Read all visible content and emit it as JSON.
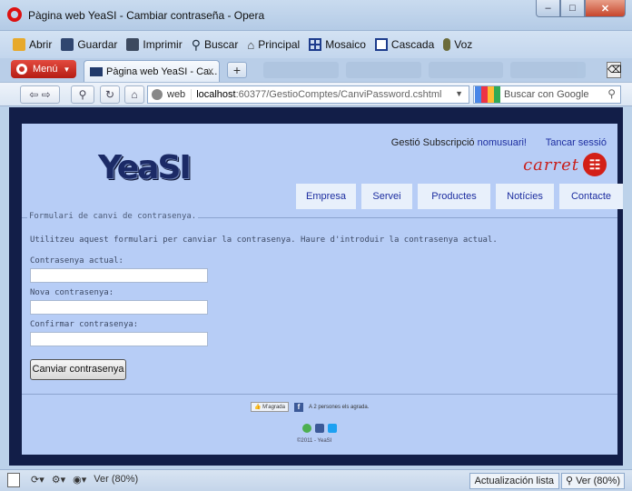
{
  "window": {
    "title": "Pàgina web YeaSI - Cambiar contraseña - Opera"
  },
  "menubar": {
    "items": [
      {
        "label": "Abrir",
        "icon": "folder-icon"
      },
      {
        "label": "Guardar",
        "icon": "save-icon"
      },
      {
        "label": "Imprimir",
        "icon": "print-icon"
      },
      {
        "label": "Buscar",
        "icon": "search-icon"
      },
      {
        "label": "Principal",
        "icon": "home-icon"
      },
      {
        "label": "Mosaico",
        "icon": "tile-icon"
      },
      {
        "label": "Cascada",
        "icon": "cascade-icon"
      },
      {
        "label": "Voz",
        "icon": "microphone-icon"
      }
    ]
  },
  "tabbar": {
    "menu_label": "Menú",
    "tab_title": "Pàgina web YeaSI - Ca...",
    "close_glyph": "x",
    "new_tab_glyph": "+"
  },
  "navbar": {
    "scheme": "web",
    "url_host": "localhost",
    "url_path": ":60377/GestioComptes/CanviPassword.cshtml",
    "search_placeholder": "Buscar con Google"
  },
  "header": {
    "logo": "YeaSI",
    "user_prefix": "Gestió Subscripció",
    "username": "nomusuari!",
    "logout": "Tancar sessió",
    "cart_label": "carret"
  },
  "nav": {
    "tabs": [
      "Empresa",
      "Servei",
      "Productes",
      "Notícies",
      "Contacte"
    ]
  },
  "form": {
    "legend": "Formulari de canvi de contrasenya.",
    "intro": "Utilitzeu aquest formulari per canviar la contrasenya. Haure d'introduir la contrasenya actual.",
    "fields": [
      {
        "label": "Contrasenya actual:",
        "value": ""
      },
      {
        "label": "Nova contrasenya:",
        "value": ""
      },
      {
        "label": "Confirmar contrasenya:",
        "value": ""
      }
    ],
    "submit": "Canviar contrasenya"
  },
  "footer": {
    "like_button": "M'agrada",
    "like_text": "A 2 persones els agrada.",
    "copyright": "©2011 - YeaSI"
  },
  "statusbar": {
    "zoom_left": "Ver (80%)",
    "update": "Actualización lista",
    "zoom_right": "Ver (80%)"
  }
}
